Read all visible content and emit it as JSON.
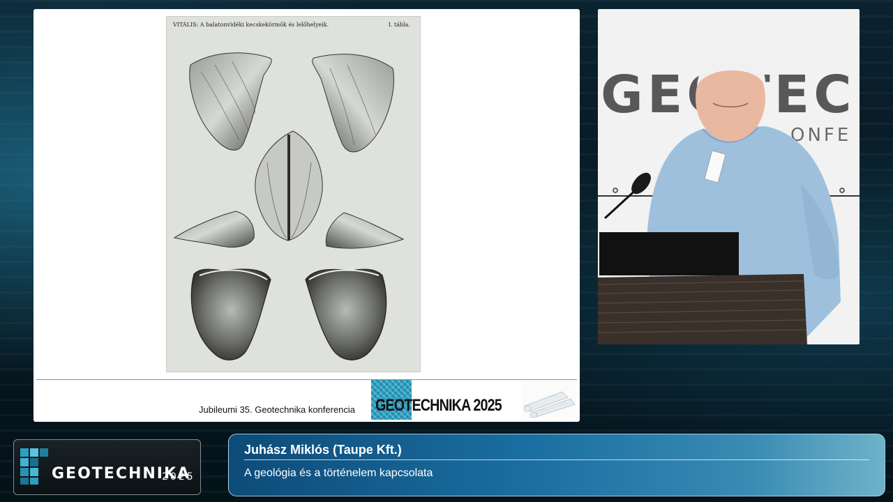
{
  "slide": {
    "plate_header_left": "VITÁLIS: A balatonvidéki kecskekörmök és lelőhelyeik.",
    "plate_header_right": "I. tábla.",
    "footer_text": "Jubileumi 35. Geotechnika konferencia",
    "conference_logo_text": "GEOTECHNIKA 2025"
  },
  "video": {
    "backdrop_word": "GEOTECHNI",
    "backdrop_subword": "ONFE"
  },
  "lower_third": {
    "brand_name": "GEOTECHNIKA",
    "brand_year": "2025",
    "speaker": "Juhász Miklós (Taupe Kft.)",
    "talk_title": "A geológia és a történelem kapcsolata"
  },
  "colors": {
    "accent_blue": "#1a6ea0",
    "logo_teal": "#2aa0c2"
  }
}
